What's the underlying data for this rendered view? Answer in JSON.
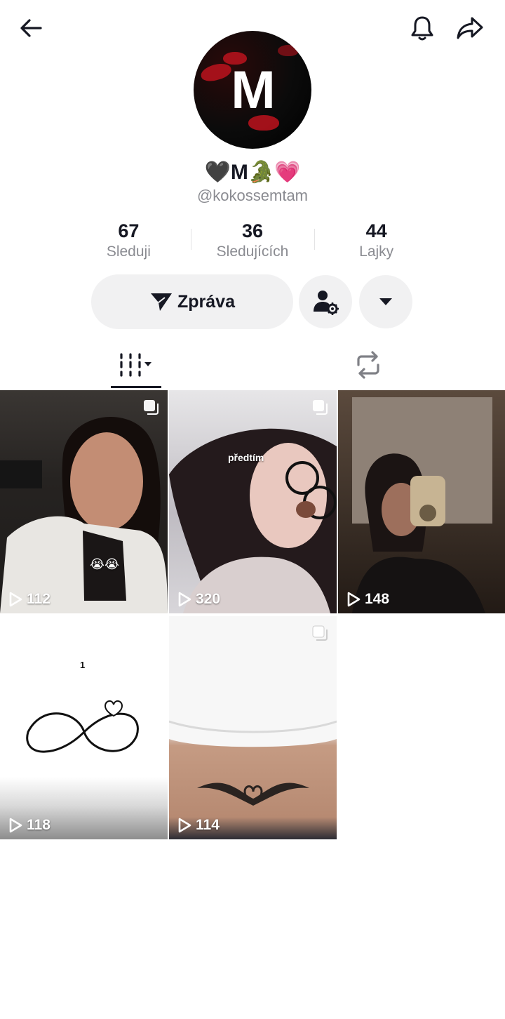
{
  "header": {
    "back_icon": "arrow-left-icon",
    "bell_icon": "bell-icon",
    "share_icon": "share-arrow-icon"
  },
  "profile": {
    "avatar_letter": "M",
    "display_name": "🖤M🐊💗",
    "username": "@kokossemtam"
  },
  "stats": [
    {
      "value": "67",
      "label": "Sleduji"
    },
    {
      "value": "36",
      "label": "Sledujících"
    },
    {
      "value": "44",
      "label": "Lajky"
    }
  ],
  "actions": {
    "message_label": "Zpráva",
    "add_friend_icon": "person-gear-icon",
    "more_icon": "caret-down-icon"
  },
  "tabs": {
    "videos_icon": "grid-lines-icon",
    "repost_icon": "repost-icon"
  },
  "videos": [
    {
      "views": "112",
      "emoji": "😭😭"
    },
    {
      "views": "320",
      "caption": "předtím"
    },
    {
      "views": "148"
    },
    {
      "views": "118",
      "caption": "1"
    },
    {
      "views": "114"
    }
  ]
}
